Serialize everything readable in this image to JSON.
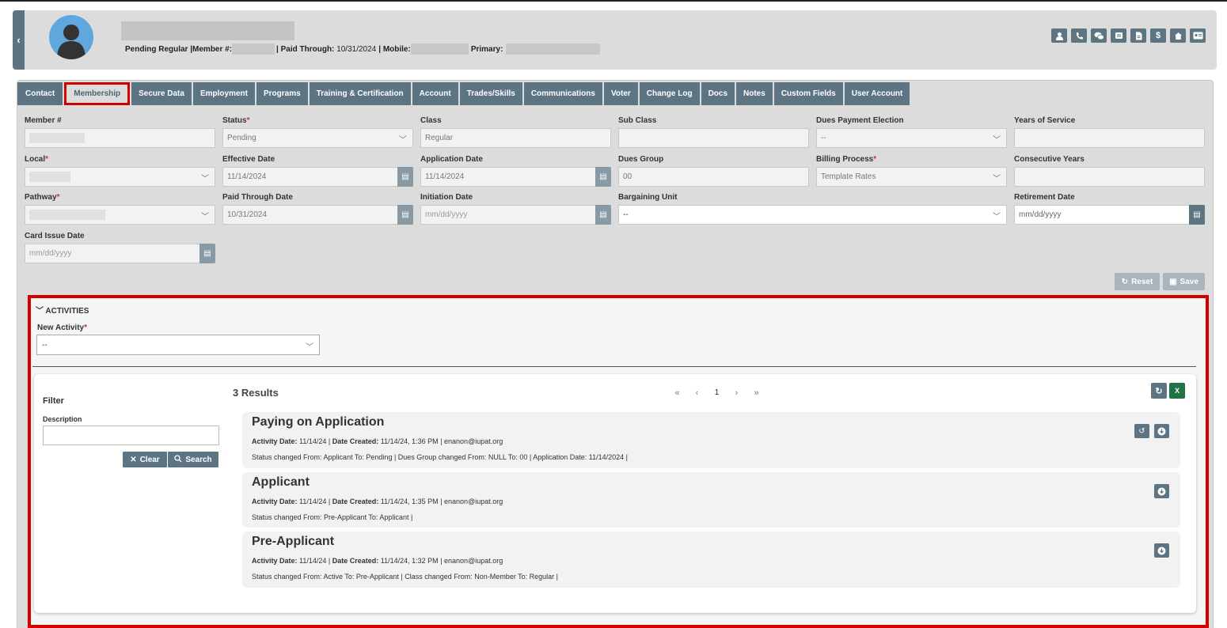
{
  "header": {
    "status_text": "Pending Regular | ",
    "member_label": "Member #:",
    "paid_label": "| Paid Through:",
    "paid_value": "10/31/2024",
    "mobile_label": "| Mobile:",
    "primary_label": "Primary:",
    "icons": [
      "user-icon",
      "phone-icon",
      "chat-icon",
      "message-icon",
      "document-icon",
      "dollar-icon",
      "home-icon",
      "id-card-icon"
    ]
  },
  "tabs": [
    "Contact",
    "Membership",
    "Secure Data",
    "Employment",
    "Programs",
    "Training & Certification",
    "Account",
    "Trades/Skills",
    "Communications",
    "Voter",
    "Change Log",
    "Docs",
    "Notes",
    "Custom Fields",
    "User Account"
  ],
  "form": {
    "member_num": {
      "label": "Member #"
    },
    "status": {
      "label": "Status",
      "value": "Pending"
    },
    "class": {
      "label": "Class",
      "value": "Regular"
    },
    "sub_class": {
      "label": "Sub Class",
      "value": ""
    },
    "dues_payment": {
      "label": "Dues Payment Election",
      "value": "--"
    },
    "years_service": {
      "label": "Years of Service",
      "value": ""
    },
    "local": {
      "label": "Local"
    },
    "effective_date": {
      "label": "Effective Date",
      "value": "11/14/2024"
    },
    "application_date": {
      "label": "Application Date",
      "value": "11/14/2024"
    },
    "dues_group": {
      "label": "Dues Group",
      "value": "00"
    },
    "billing_process": {
      "label": "Billing Process",
      "value": "Template Rates"
    },
    "consecutive_years": {
      "label": "Consecutive Years",
      "value": ""
    },
    "pathway": {
      "label": "Pathway"
    },
    "paid_through": {
      "label": "Paid Through Date",
      "value": "10/31/2024"
    },
    "initiation_date": {
      "label": "Initiation Date",
      "placeholder": "mm/dd/yyyy"
    },
    "bargaining_unit": {
      "label": "Bargaining Unit",
      "value": "--"
    },
    "retirement_date": {
      "label": "Retirement Date",
      "placeholder": "mm/dd/yyyy"
    },
    "card_issue_date": {
      "label": "Card Issue Date",
      "placeholder": "mm/dd/yyyy"
    },
    "reset_label": "Reset",
    "save_label": "Save"
  },
  "activities": {
    "heading": "ACTIVITIES",
    "new_activity_label": "New Activity",
    "new_activity_value": "--",
    "filter_title": "Filter",
    "description_label": "Description",
    "clear_label": "Clear",
    "search_label": "Search",
    "results_count": "3 Results",
    "pager": {
      "first": "«",
      "prev": "‹",
      "page": "1",
      "next": "›",
      "last": "»"
    },
    "items": [
      {
        "title": "Paying on Application",
        "activity_date_label": "Activity Date:",
        "activity_date": "11/14/24",
        "date_created_label": "Date Created:",
        "date_created": "11/14/24, 1:36 PM",
        "user": "enanon@iupat.org",
        "status": "Status changed From: Applicant To: Pending | Dues Group changed From: NULL To: 00 | Application Date: 11/14/2024 |"
      },
      {
        "title": "Applicant",
        "activity_date_label": "Activity Date:",
        "activity_date": "11/14/24",
        "date_created_label": "Date Created:",
        "date_created": "11/14/24, 1:35 PM",
        "user": "enanon@iupat.org",
        "status": "Status changed From: Pre-Applicant To: Applicant |"
      },
      {
        "title": "Pre-Applicant",
        "activity_date_label": "Activity Date:",
        "activity_date": "11/14/24",
        "date_created_label": "Date Created:",
        "date_created": "11/14/24, 1:32 PM",
        "user": "enanon@iupat.org",
        "status": "Status changed From: Active To: Pre-Applicant | Class changed From: Non-Member To: Regular |"
      }
    ]
  },
  "colors": {
    "accent": "#5d7483",
    "highlight": "#d40000",
    "excel": "#217346"
  }
}
